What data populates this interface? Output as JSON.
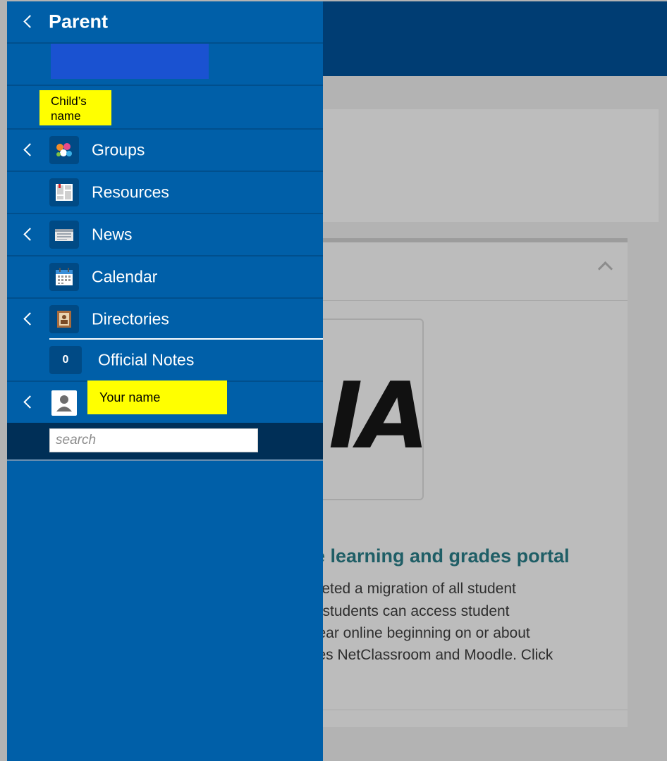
{
  "sidebar": {
    "title": "Parent",
    "child_placeholder": "Child’s name",
    "items": [
      {
        "label": "Groups",
        "icon": "groups-icon",
        "expandable": true
      },
      {
        "label": "Resources",
        "icon": "resources-icon",
        "expandable": false
      },
      {
        "label": "News",
        "icon": "news-icon",
        "expandable": true
      },
      {
        "label": "Calendar",
        "icon": "calendar-icon",
        "expandable": false
      },
      {
        "label": "Directories",
        "icon": "directories-icon",
        "expandable": true
      }
    ],
    "official_notes": {
      "count": "0",
      "label": "Official Notes"
    },
    "user_placeholder": "Your name",
    "search_placeholder": "search"
  },
  "content": {
    "logo_text": "IA",
    "heading": "e learning and grades portal",
    "paragraph_lines": [
      "pleted a migration of all student",
      "d students can access student",
      "year online beginning on or about",
      "ces NetClassroom and Moodle. Click"
    ]
  },
  "colors": {
    "sidebar": "#005fa8",
    "topbar": "#003d73",
    "search_strip": "#002f57",
    "highlight": "#ffff00",
    "heading": "#1f5e66"
  }
}
